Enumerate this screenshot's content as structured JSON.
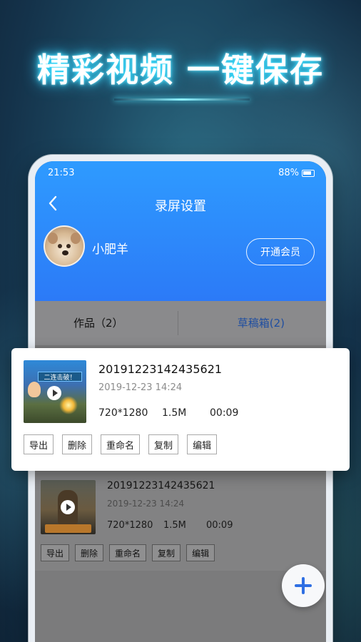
{
  "promo": {
    "headline": "精彩视频 一键保存"
  },
  "status_bar": {
    "time": "21:53",
    "battery": "88%"
  },
  "header": {
    "title": "录屏设置"
  },
  "profile": {
    "username": "小肥羊",
    "vip_button": "开通会员"
  },
  "tabs": [
    {
      "label": "作品（2）"
    },
    {
      "label": "草稿箱(2)",
      "active": true
    }
  ],
  "recordings": [
    {
      "title": "20191223142435621",
      "date": "2019-12-23 14:24",
      "resolution": "720*1280",
      "size": "1.5M",
      "duration": "00:09",
      "thumbnail_caption": "二连击破！",
      "actions": [
        "导出",
        "删除",
        "重命名",
        "复制",
        "编辑"
      ]
    },
    {
      "title": "20191223142435621",
      "date": "2019-12-23 14:24",
      "resolution": "720*1280",
      "size": "1.5M",
      "duration": "00:09",
      "actions": [
        "导出",
        "删除",
        "重命名",
        "复制",
        "编辑"
      ]
    }
  ],
  "icons": {
    "back": "chevron-left-icon",
    "battery": "battery-icon",
    "play": "play-icon",
    "add": "plus-icon"
  },
  "colors": {
    "accent": "#2c7af7",
    "active_tab": "#1f4ea1",
    "fab_plus": "#2f6fe3",
    "headline_glow": "#35e0ff"
  }
}
